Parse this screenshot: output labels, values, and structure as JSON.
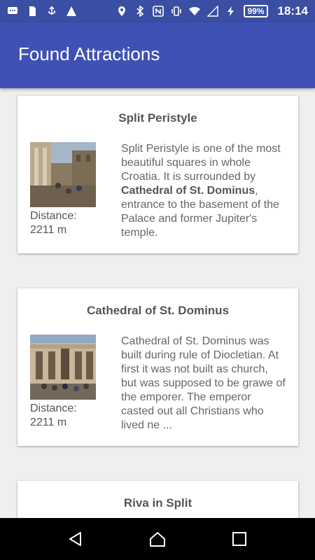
{
  "status_bar": {
    "battery": "99%",
    "time": "18:14"
  },
  "app_bar": {
    "title": "Found Attractions"
  },
  "attractions": [
    {
      "title": "Split Peristyle",
      "distance_label": "Distance:",
      "distance_value": "2211 m",
      "desc_part1": "Split Peristyle is one of the most beautiful squares in whole Croatia. It is surrounded by ",
      "desc_bold": "Cathedral of St. Dominus",
      "desc_part2": ", entrance to the basement of the Palace and former Jupiter's temple."
    },
    {
      "title": "Cathedral of St. Dominus",
      "distance_label": "Distance:",
      "distance_value": "2211 m",
      "desc_part1": "Cathedral of St. Dominus was built during rule of Diocletian. At first it was not built as church, but was supposed to be grawe of the emporer. The emperor casted out all Christians who lived ne ...",
      "desc_bold": "",
      "desc_part2": ""
    },
    {
      "title": "Riva in Split"
    }
  ]
}
